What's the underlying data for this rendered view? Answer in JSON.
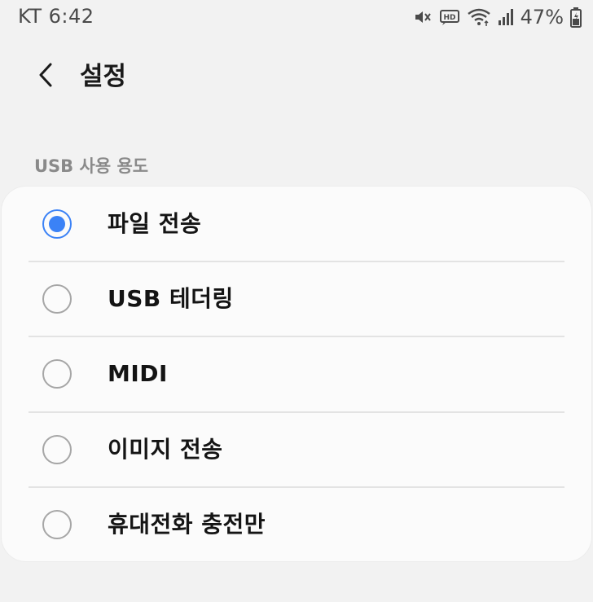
{
  "status_bar": {
    "carrier_time": "KT 6:42",
    "battery": "47%",
    "icons": [
      "mute-icon",
      "hd-icon",
      "wifi-icon",
      "signal-icon",
      "battery-icon"
    ]
  },
  "header": {
    "back_icon": "chevron-left-icon",
    "title": "설정"
  },
  "section": {
    "label": "USB 사용 용도"
  },
  "options": [
    {
      "label": "파일 전송",
      "selected": true
    },
    {
      "label": "USB 테더링",
      "selected": false
    },
    {
      "label": "MIDI",
      "selected": false
    },
    {
      "label": "이미지 전송",
      "selected": false
    },
    {
      "label": "휴대전화 충전만",
      "selected": false
    }
  ],
  "colors": {
    "accent": "#3b82f6",
    "background": "#f2f2f2",
    "card": "#fbfbfb"
  }
}
